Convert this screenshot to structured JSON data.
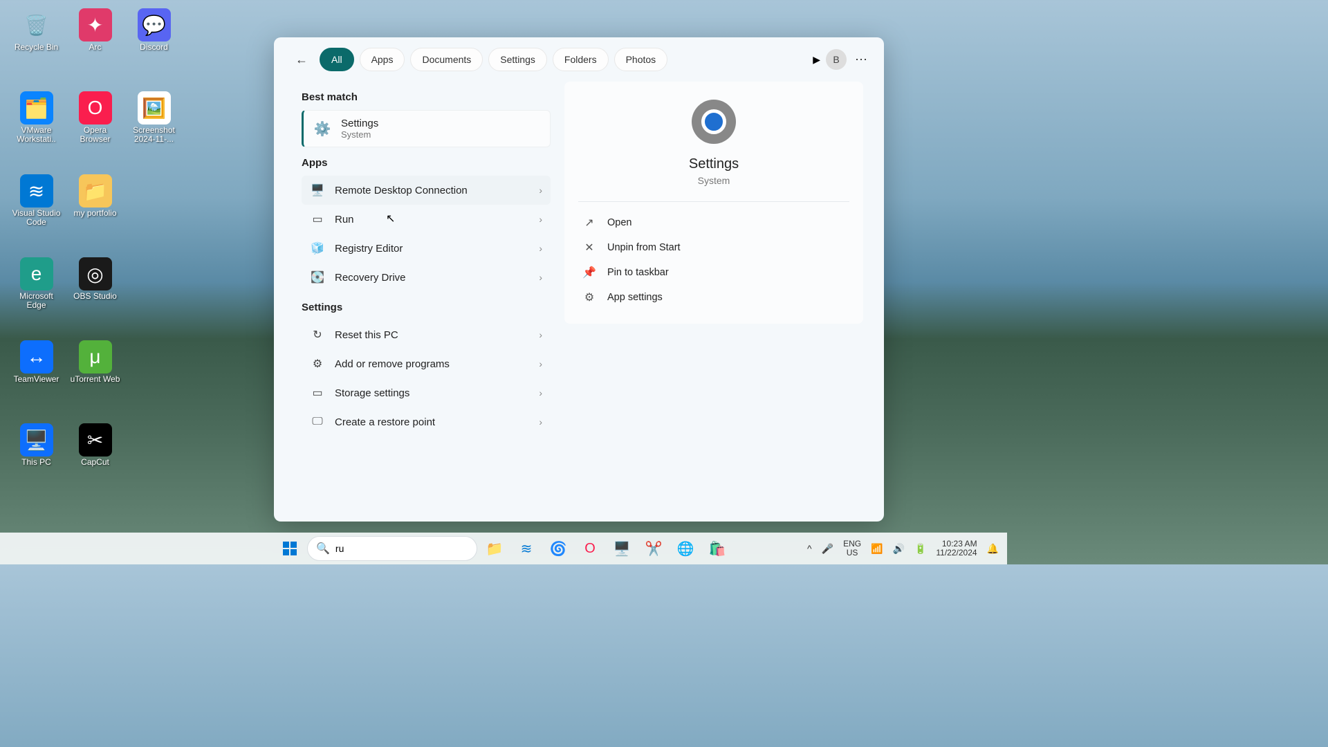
{
  "desktop": {
    "icons": [
      {
        "label": "Recycle Bin",
        "glyph": "🗑️",
        "bg": ""
      },
      {
        "label": "Arc",
        "glyph": "✦",
        "bg": "#e03a6a"
      },
      {
        "label": "Discord",
        "glyph": "💬",
        "bg": "#5865F2"
      },
      {
        "label": "VMware Workstati..",
        "glyph": "🗂️",
        "bg": "#0a84ff"
      },
      {
        "label": "Opera Browser",
        "glyph": "O",
        "bg": "#fa1e4e"
      },
      {
        "label": "Screenshot 2024-11-...",
        "glyph": "🖼️",
        "bg": "#fff"
      },
      {
        "label": "Visual Studio Code",
        "glyph": "≋",
        "bg": "#0078d4"
      },
      {
        "label": "my portfolio",
        "glyph": "📁",
        "bg": "#f7c65a"
      },
      {
        "label": "",
        "glyph": "",
        "bg": ""
      },
      {
        "label": "Microsoft Edge",
        "glyph": "e",
        "bg": "#1f9d8a"
      },
      {
        "label": "OBS Studio",
        "glyph": "◎",
        "bg": "#1a1a1a"
      },
      {
        "label": "",
        "glyph": "",
        "bg": ""
      },
      {
        "label": "TeamViewer",
        "glyph": "↔",
        "bg": "#0d6efd"
      },
      {
        "label": "uTorrent Web",
        "glyph": "μ",
        "bg": "#53b13b"
      },
      {
        "label": "",
        "glyph": "",
        "bg": ""
      },
      {
        "label": "This PC",
        "glyph": "🖥️",
        "bg": "#0d6efd"
      },
      {
        "label": "CapCut",
        "glyph": "✂",
        "bg": "#000"
      }
    ]
  },
  "search": {
    "tabs": [
      "All",
      "Apps",
      "Documents",
      "Settings",
      "Folders",
      "Photos"
    ],
    "active_tab": "All",
    "avatar_initial": "B",
    "best_match_header": "Best match",
    "best_match": {
      "title": "Settings",
      "subtitle": "System"
    },
    "apps_header": "Apps",
    "apps": [
      {
        "label": "Remote Desktop Connection",
        "glyph": "🖥️",
        "hovered": true
      },
      {
        "label": "Run",
        "glyph": "▭"
      },
      {
        "label": "Registry Editor",
        "glyph": "🧊"
      },
      {
        "label": "Recovery Drive",
        "glyph": "💽"
      }
    ],
    "settings_header": "Settings",
    "settings": [
      {
        "label": "Reset this PC",
        "glyph": "↻"
      },
      {
        "label": "Add or remove programs",
        "glyph": "⚙"
      },
      {
        "label": "Storage settings",
        "glyph": "▭"
      },
      {
        "label": "Create a restore point",
        "glyph": "🖵"
      }
    ],
    "preview": {
      "title": "Settings",
      "subtitle": "System",
      "actions": [
        {
          "label": "Open",
          "glyph": "↗"
        },
        {
          "label": "Unpin from Start",
          "glyph": "✕"
        },
        {
          "label": "Pin to taskbar",
          "glyph": "📌"
        },
        {
          "label": "App settings",
          "glyph": "⚙"
        }
      ]
    },
    "input_value": "ru"
  },
  "taskbar": {
    "lang_top": "ENG",
    "lang_bottom": "US",
    "time": "10:23 AM",
    "date": "11/22/2024"
  }
}
